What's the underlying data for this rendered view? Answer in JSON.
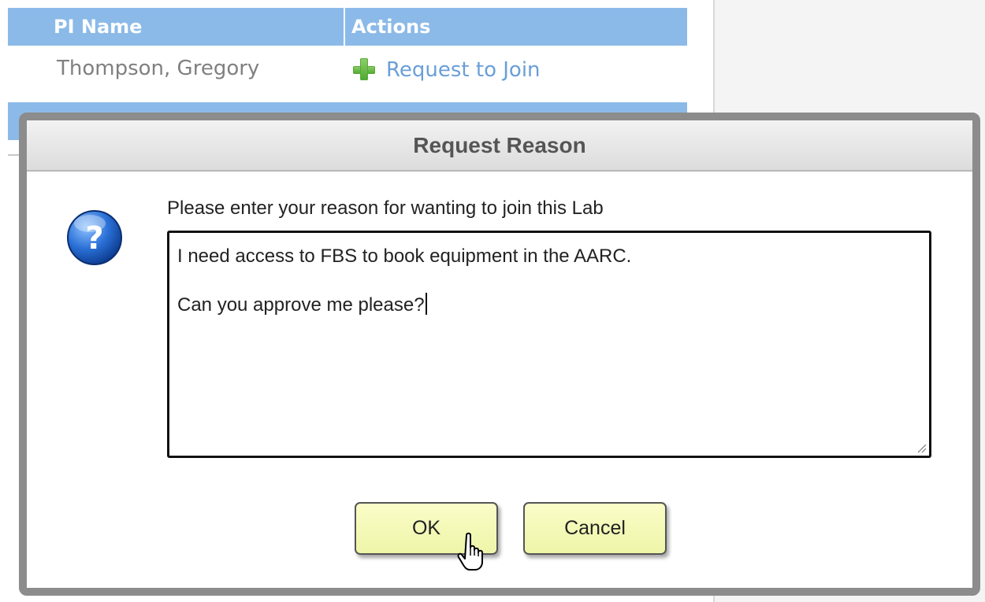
{
  "table": {
    "columns": [
      "PI Name",
      "Actions"
    ],
    "rows": [
      {
        "pi_name": "Thompson, Gregory",
        "action_label": "Request to Join",
        "action_icon": "plus-icon"
      }
    ]
  },
  "dialog": {
    "title": "Request Reason",
    "icon": "question-icon",
    "prompt": "Please enter your reason for wanting to join this Lab",
    "reason_text": {
      "line1": "I need access to FBS to book equipment in the AARC.",
      "line2": "Can you approve me please?"
    },
    "buttons": {
      "ok": "OK",
      "cancel": "Cancel"
    }
  },
  "colors": {
    "header_blue": "#8bbae8",
    "link_blue": "#6a9fd8",
    "button_yellow": "#f4f9b8",
    "dialog_border": "#8c8c8c"
  }
}
